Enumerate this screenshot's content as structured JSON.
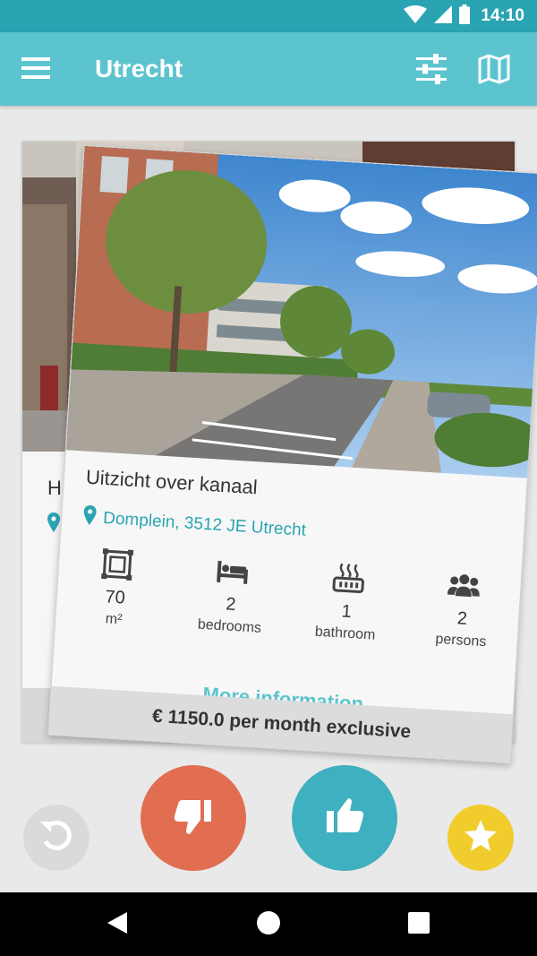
{
  "status_bar": {
    "time": "14:10",
    "icons": [
      "wifi-icon",
      "signal-icon",
      "battery-icon"
    ]
  },
  "app_bar": {
    "title": "Utrecht",
    "left_icon": "menu-icon",
    "right_icons": [
      "filter-icon",
      "map-icon"
    ]
  },
  "back_card": {
    "title_stub": "H"
  },
  "listing": {
    "title": "Uitzicht over kanaal",
    "address": "Domplein, 3512 JE Utrecht",
    "features": [
      {
        "icon": "area-icon",
        "value": "70",
        "unit": "m²"
      },
      {
        "icon": "bed-icon",
        "value": "2",
        "unit": "bedrooms"
      },
      {
        "icon": "bathtub-icon",
        "value": "1",
        "unit": "bathroom"
      },
      {
        "icon": "persons-icon",
        "value": "2",
        "unit": "persons"
      }
    ],
    "more_info": "More information",
    "price": "€ 1150.0 per month exclusive"
  },
  "actions": [
    "undo-icon",
    "thumbs-down-icon",
    "thumbs-up-icon",
    "star-icon"
  ],
  "colors": {
    "primary": "#5cc4cf",
    "primary_dark": "#2aa4b3",
    "dislike": "#e26e52",
    "like": "#3fb0bf",
    "favorite": "#f0cd2c"
  }
}
